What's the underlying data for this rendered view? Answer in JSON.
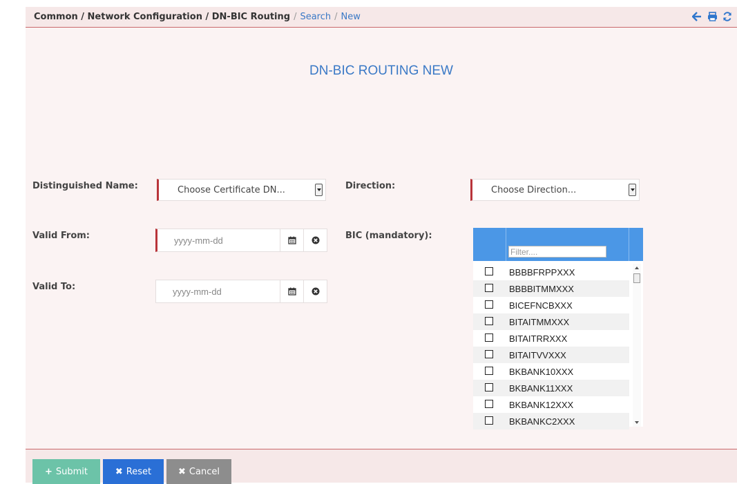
{
  "breadcrumb": {
    "root": "Common / Network Configuration / DN-BIC Routing",
    "search": "Search",
    "new": "New",
    "separator": "/"
  },
  "header_icons": [
    "back-arrow-icon",
    "print-icon",
    "refresh-icon"
  ],
  "title": "DN-BIC ROUTING NEW",
  "form": {
    "distinguished_name_label": "Distinguished Name:",
    "distinguished_name_value": "Choose Certificate DN...",
    "direction_label": "Direction:",
    "direction_value": "Choose Direction...",
    "valid_from_label": "Valid From:",
    "valid_from_placeholder": "yyyy-mm-dd",
    "valid_to_label": "Valid To:",
    "valid_to_placeholder": "yyyy-mm-dd",
    "bic_label": "BIC (mandatory):"
  },
  "bic_list": {
    "filter_placeholder": "Filter....",
    "items": [
      "BBBBFRPPXXX",
      "BBBBITMMXXX",
      "BICEFNCBXXX",
      "BITAITMMXXX",
      "BITAITRRXXX",
      "BITAITVVXXX",
      "BKBANK10XXX",
      "BKBANK11XXX",
      "BKBANK12XXX",
      "BKBANKC2XXX"
    ]
  },
  "buttons": {
    "submit": "Submit",
    "reset": "Reset",
    "cancel": "Cancel"
  },
  "colors": {
    "accent_blue": "#3a79c6",
    "required_bar": "#b9343a",
    "submit": "#6cc3a8",
    "reset": "#2a6fd6",
    "cancel": "#8d8d8d",
    "bic_header": "#4b97e6"
  }
}
